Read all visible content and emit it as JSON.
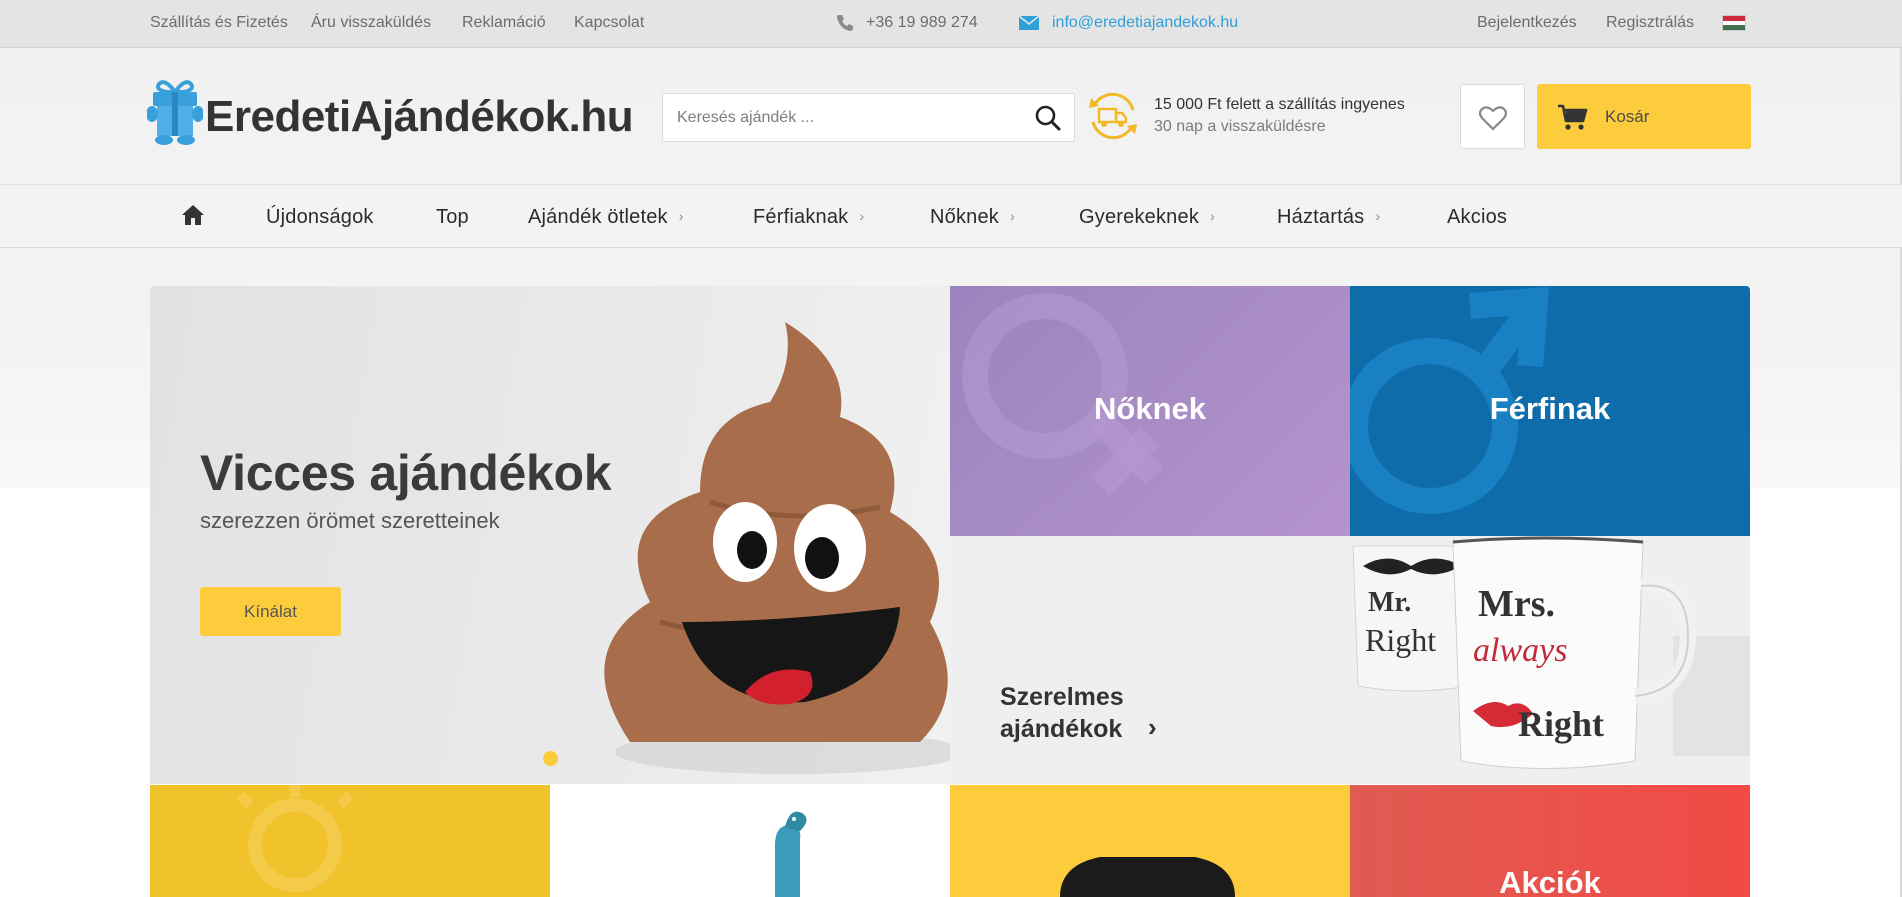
{
  "topbar": {
    "links": [
      "Szállítás és Fizetés",
      "Áru visszaküldés",
      "Reklamáció",
      "Kapcsolat"
    ],
    "phone": "+36 19 989 274",
    "email": "info@eredetiajandekok.hu",
    "login": "Bejelentkezés",
    "register": "Regisztrálás",
    "language_icon": "hungarian-flag-icon"
  },
  "header": {
    "logo_text": "EredetiAjándékok.hu",
    "search_placeholder": "Keresés ajándék ...",
    "shipping_line1": "15 000 Ft felett a szállítás ingyenes",
    "shipping_line2": "30 nap a visszaküldésre",
    "cart_label": "Kosár",
    "icons": [
      "gift-icon",
      "search-icon",
      "delivery-truck-icon",
      "heart-icon",
      "cart-icon"
    ]
  },
  "nav": {
    "home_icon": "home-icon",
    "items": [
      "Újdonságok",
      "Top",
      "Ajándék ötletek",
      "Férfiaknak",
      "Nőknek",
      "Gyerekeknek",
      "Háztartás",
      "Akcios"
    ]
  },
  "hero": {
    "title": "Vicces ajándékok",
    "subtitle": "szerezzen örömet szeretteinek",
    "button": "Kínálat"
  },
  "tiles": {
    "women": "Nőknek",
    "men": "Férfinak",
    "love_line1": "Szerelmes",
    "love_line2": "ajándékok",
    "sale": "Akciók"
  },
  "colors": {
    "accent_yellow": "#fdcc3c",
    "women_purple": "#a98ac6",
    "men_blue": "#0f6cab",
    "sale_red": "#ee4e49",
    "link_blue": "#2f9fd8"
  }
}
